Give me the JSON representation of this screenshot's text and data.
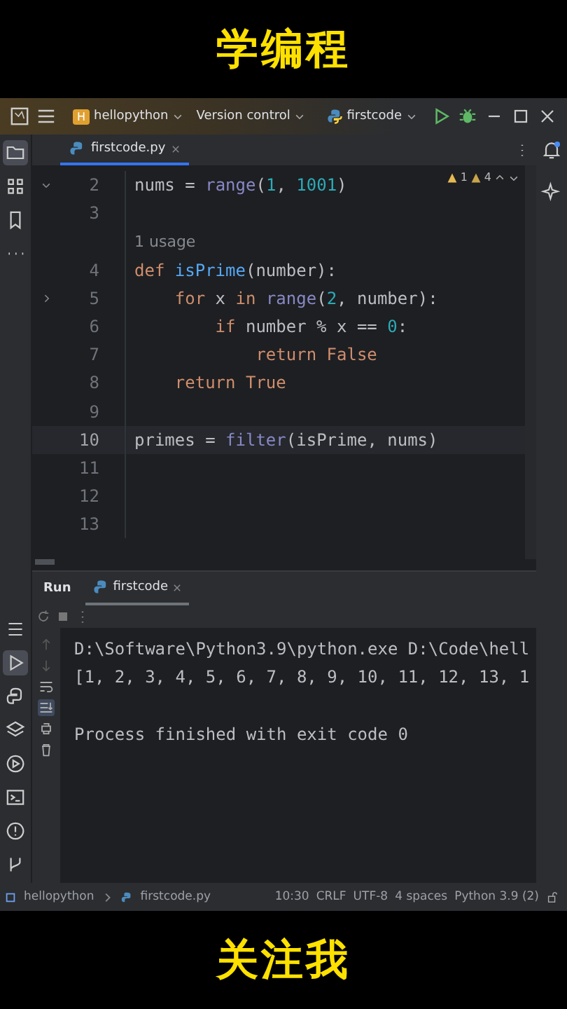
{
  "top_caption": "学编程",
  "bottom_caption": "关注我",
  "title_bar": {
    "project_badge": "H",
    "project": "hellopython",
    "version_control": "Version control",
    "run_config": "firstcode"
  },
  "left_stripe_top": [
    {
      "kind": "folder",
      "selected": true
    },
    {
      "kind": "structure",
      "selected": false
    },
    {
      "kind": "bookmark",
      "selected": false
    },
    {
      "kind": "more",
      "selected": false
    }
  ],
  "left_stripe_bottom": [
    {
      "kind": "list",
      "selected": false
    },
    {
      "kind": "run",
      "selected": true
    },
    {
      "kind": "python",
      "selected": false
    },
    {
      "kind": "layers",
      "selected": false
    },
    {
      "kind": "services",
      "selected": false
    },
    {
      "kind": "terminal",
      "selected": false
    },
    {
      "kind": "problems",
      "selected": false
    },
    {
      "kind": "git",
      "selected": false
    }
  ],
  "editor_tabs": [
    {
      "label": "firstcode.py",
      "selected": true
    }
  ],
  "inspections": {
    "errors": "1",
    "warnings": "4"
  },
  "code_lines": [
    {
      "number": "2",
      "current": false,
      "expanded": true,
      "tokens": [
        {
          "text": "nums",
          "kind": "ident"
        },
        {
          "text": " = ",
          "kind": "plain"
        },
        {
          "text": "range",
          "kind": "builtin"
        },
        {
          "text": "(",
          "kind": "plain"
        },
        {
          "text": "1",
          "kind": "num"
        },
        {
          "text": ", ",
          "kind": "plain"
        },
        {
          "text": "1001",
          "kind": "num"
        },
        {
          "text": ")",
          "kind": "plain"
        }
      ]
    },
    {
      "number": "3",
      "current": false
    },
    {
      "hint": "1 usage"
    },
    {
      "number": "4",
      "current": false,
      "tokens": [
        {
          "text": "def ",
          "kind": "kw"
        },
        {
          "text": "isPrime",
          "kind": "fn"
        },
        {
          "text": "(number):",
          "kind": "plain"
        }
      ]
    },
    {
      "number": "5",
      "current": false,
      "expanded": false,
      "tokens": [
        {
          "text": "    for",
          "kind": "kw"
        },
        {
          "text": " x ",
          "kind": "plain"
        },
        {
          "text": "in ",
          "kind": "kw"
        },
        {
          "text": "range",
          "kind": "builtin"
        },
        {
          "text": "(",
          "kind": "plain"
        },
        {
          "text": "2",
          "kind": "num"
        },
        {
          "text": ", number):",
          "kind": "plain"
        }
      ]
    },
    {
      "number": "6",
      "current": false,
      "tokens": [
        {
          "text": "        if",
          "kind": "kw"
        },
        {
          "text": " number % x == ",
          "kind": "plain"
        },
        {
          "text": "0",
          "kind": "num"
        },
        {
          "text": ":",
          "kind": "plain"
        }
      ]
    },
    {
      "number": "7",
      "current": false,
      "tokens": [
        {
          "text": "            return False",
          "kind": "kw"
        }
      ]
    },
    {
      "number": "8",
      "current": false,
      "tokens": [
        {
          "text": "    return True",
          "kind": "kw"
        }
      ]
    },
    {
      "number": "9",
      "current": false
    },
    {
      "number": "10",
      "current": true,
      "tokens": [
        {
          "text": "primes = ",
          "kind": "plain"
        },
        {
          "text": "filter",
          "kind": "builtin"
        },
        {
          "text": "(isPrime, nums)",
          "kind": "plain"
        }
      ]
    },
    {
      "number": "11",
      "current": false
    },
    {
      "number": "12",
      "current": false
    },
    {
      "number": "13",
      "current": false
    }
  ],
  "run_panel": {
    "title": "Run",
    "tabs": [
      {
        "label": "firstcode",
        "selected": true
      }
    ],
    "side_tools": [
      {
        "kind": "up",
        "selected": false
      },
      {
        "kind": "down",
        "selected": false
      },
      {
        "kind": "wrap",
        "selected": false
      },
      {
        "kind": "scroll-end",
        "selected": true
      },
      {
        "kind": "print",
        "selected": false
      },
      {
        "kind": "trash",
        "selected": false
      }
    ],
    "console_output": [
      "D:\\Software\\Python3.9\\python.exe D:\\Code\\hell",
      "[1, 2, 3, 4, 5, 6, 7, 8, 9, 10, 11, 12, 13, 1"
    ],
    "exit_message": "Process finished with exit code 0"
  },
  "status_bar": {
    "breadcrumbs": [
      "hellopython",
      "firstcode.py"
    ],
    "items": [
      "10:30",
      "CRLF",
      "UTF-8",
      "4 spaces",
      "Python 3.9 (2)"
    ]
  }
}
